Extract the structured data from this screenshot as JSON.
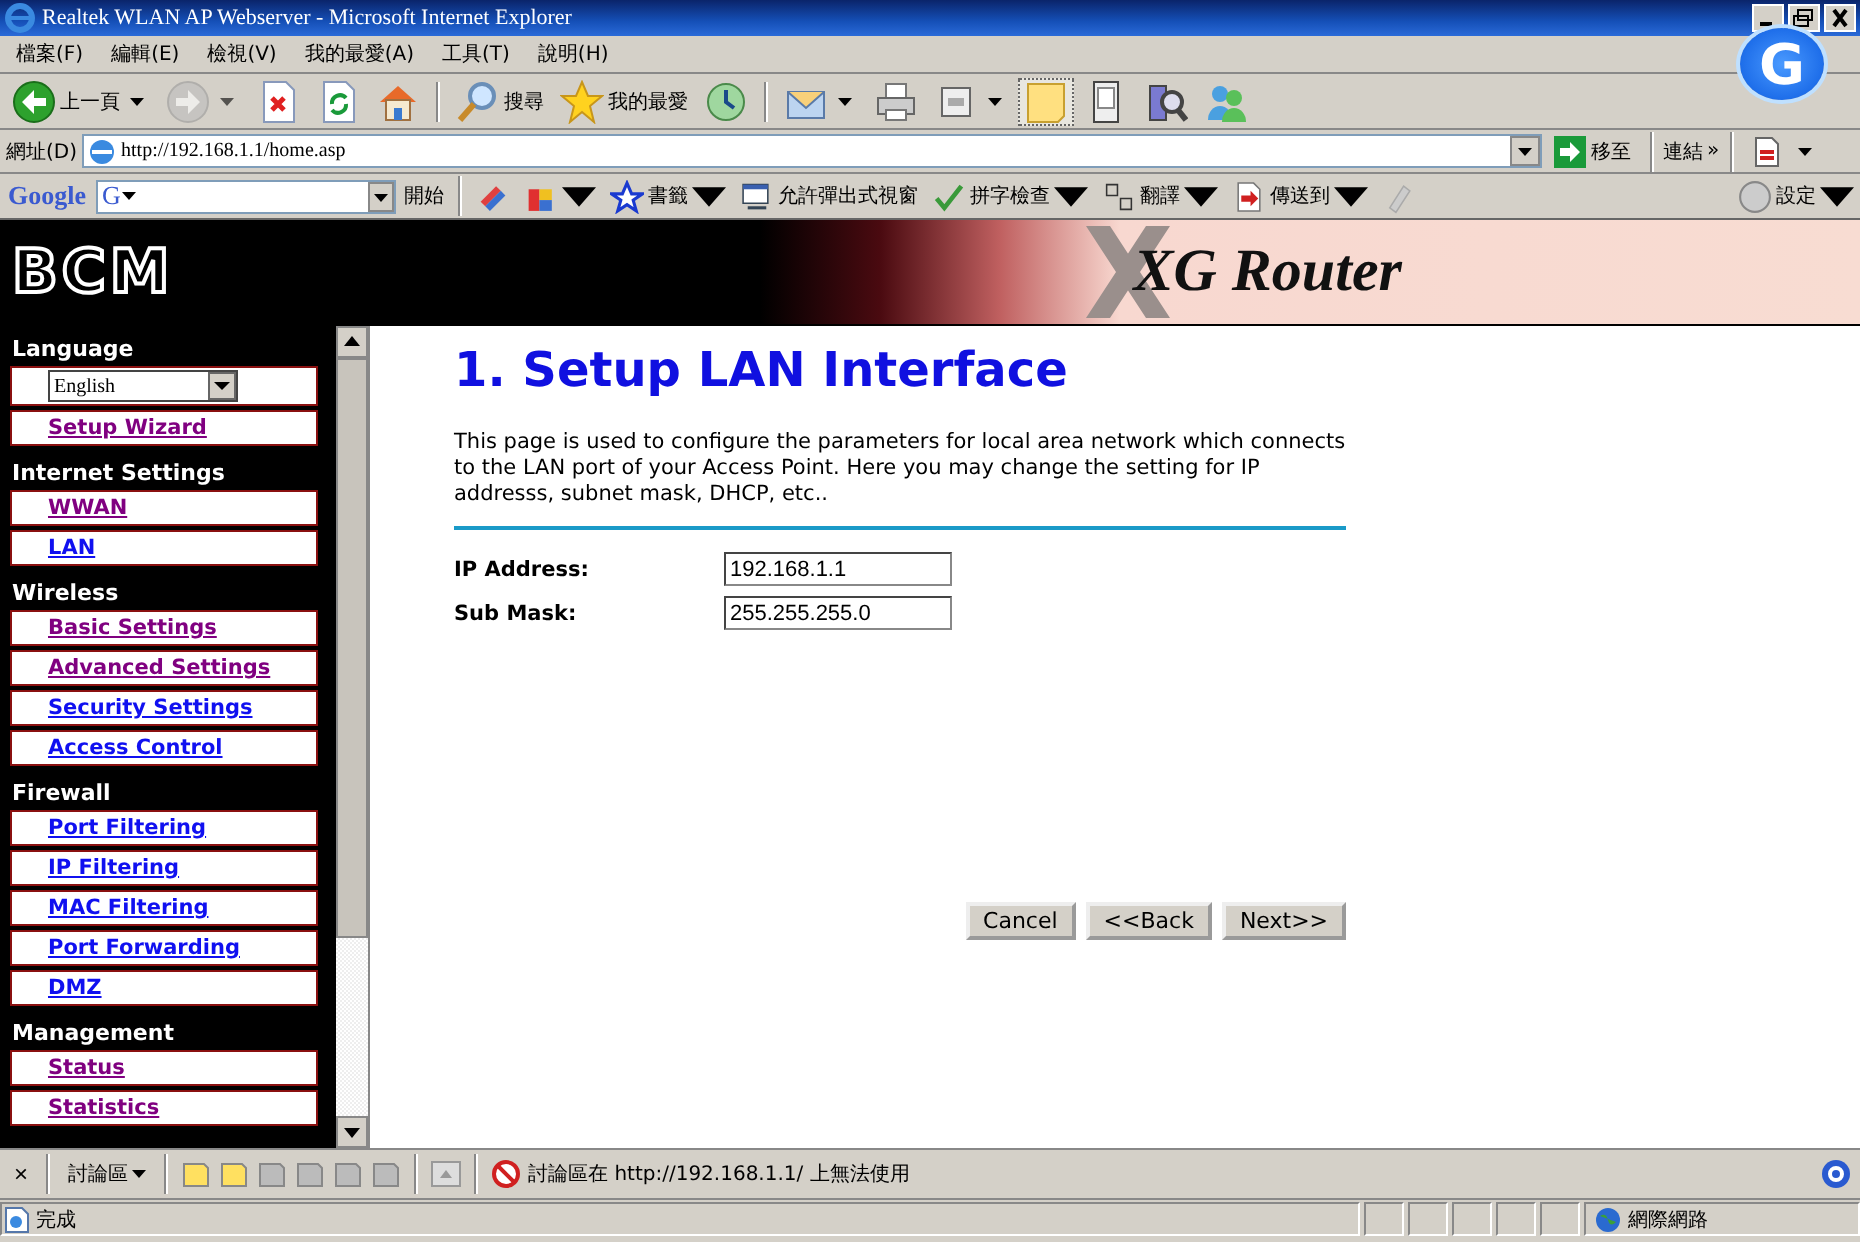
{
  "window": {
    "title": "Realtek WLAN AP Webserver - Microsoft Internet Explorer",
    "badge": "G"
  },
  "menu": [
    "檔案(F)",
    "編輯(E)",
    "檢視(V)",
    "我的最愛(A)",
    "工具(T)",
    "說明(H)"
  ],
  "toolbar": [
    {
      "kind": "back",
      "label": "上一頁",
      "dropdown": true,
      "disabled": false
    },
    {
      "kind": "forward",
      "dropdown": true,
      "disabled": true
    },
    {
      "kind": "stop",
      "dropdown": false,
      "disabled": false
    },
    {
      "kind": "refresh",
      "dropdown": false,
      "disabled": false
    },
    {
      "kind": "home",
      "dropdown": false,
      "disabled": false
    },
    {
      "kind": "separator"
    },
    {
      "kind": "search",
      "label": "搜尋",
      "dropdown": false,
      "disabled": false
    },
    {
      "kind": "star",
      "label": "我的最愛",
      "dropdown": false,
      "disabled": false
    },
    {
      "kind": "history",
      "dropdown": false,
      "disabled": false
    },
    {
      "kind": "separator"
    },
    {
      "kind": "mail",
      "dropdown": true,
      "disabled": false
    },
    {
      "kind": "print",
      "dropdown": false,
      "disabled": false
    },
    {
      "kind": "edit",
      "dropdown": true,
      "disabled": false
    },
    {
      "kind": "note",
      "dropdown": false,
      "disabled": false,
      "selected": true
    },
    {
      "kind": "device",
      "dropdown": false,
      "disabled": false
    },
    {
      "kind": "research",
      "dropdown": false,
      "disabled": false
    },
    {
      "kind": "messenger",
      "dropdown": false,
      "disabled": false
    }
  ],
  "address_bar": {
    "label": "網址(D)",
    "value": "http://192.168.1.1/home.asp",
    "go": "移至",
    "links": "連結",
    "chevron": "»"
  },
  "google_bar": {
    "logo": "Google",
    "search_prefix": "G",
    "start": "開始",
    "items": [
      {
        "kind": "pens",
        "dropdown": false
      },
      {
        "kind": "puzzle",
        "dropdown": true
      },
      {
        "kind": "bookmark",
        "label": "書籤",
        "dropdown": true
      },
      {
        "kind": "window",
        "label": "允許彈出式視窗",
        "dropdown": false
      },
      {
        "kind": "spell",
        "label": "拼字檢查",
        "dropdown": true
      },
      {
        "kind": "translate",
        "label": "翻譯",
        "dropdown": true
      },
      {
        "kind": "send",
        "label": "傳送到",
        "dropdown": true
      },
      {
        "kind": "highlighter",
        "dropdown": false
      }
    ],
    "settings": "設定"
  },
  "banner": {
    "logo": "BCM",
    "product": "XG Router"
  },
  "sidebar": {
    "sections": [
      {
        "heading": "Language",
        "items": [
          {
            "kind": "select",
            "value": "English"
          },
          {
            "kind": "link",
            "label": "Setup Wizard",
            "visited": true
          }
        ]
      },
      {
        "heading": "Internet Settings",
        "items": [
          {
            "kind": "link",
            "label": "WWAN",
            "visited": true
          },
          {
            "kind": "link",
            "label": "LAN",
            "visited": false
          }
        ]
      },
      {
        "heading": "Wireless",
        "items": [
          {
            "kind": "link",
            "label": "Basic Settings",
            "visited": true
          },
          {
            "kind": "link",
            "label": "Advanced Settings",
            "visited": true
          },
          {
            "kind": "link",
            "label": "Security Settings",
            "visited": false
          },
          {
            "kind": "link",
            "label": "Access Control",
            "visited": false
          }
        ]
      },
      {
        "heading": "Firewall",
        "items": [
          {
            "kind": "link",
            "label": "Port Filtering",
            "visited": false
          },
          {
            "kind": "link",
            "label": "IP Filtering",
            "visited": false
          },
          {
            "kind": "link",
            "label": "MAC Filtering",
            "visited": false
          },
          {
            "kind": "link",
            "label": "Port Forwarding",
            "visited": false
          },
          {
            "kind": "link",
            "label": "DMZ",
            "visited": false
          }
        ]
      },
      {
        "heading": "Management",
        "items": [
          {
            "kind": "link",
            "label": "Status",
            "visited": true
          },
          {
            "kind": "link",
            "label": "Statistics",
            "visited": true
          }
        ]
      }
    ]
  },
  "main": {
    "title": "1. Setup LAN Interface",
    "description": "This page is used to configure the parameters for local area network which connects to the LAN port of your Access Point. Here you may change the setting for IP addresss, subnet mask, DHCP, etc..",
    "fields": [
      {
        "label": "IP Address:",
        "value": "192.168.1.1"
      },
      {
        "label": "Sub Mask:",
        "value": "255.255.255.0"
      }
    ],
    "buttons": [
      "Cancel",
      "<<Back",
      "Next>>"
    ]
  },
  "discussion_bar": {
    "close": "×",
    "label": "討論區",
    "message": "討論區在 http://192.168.1.1/ 上無法使用"
  },
  "status_bar": {
    "text": "完成",
    "zone": "網際網路"
  }
}
